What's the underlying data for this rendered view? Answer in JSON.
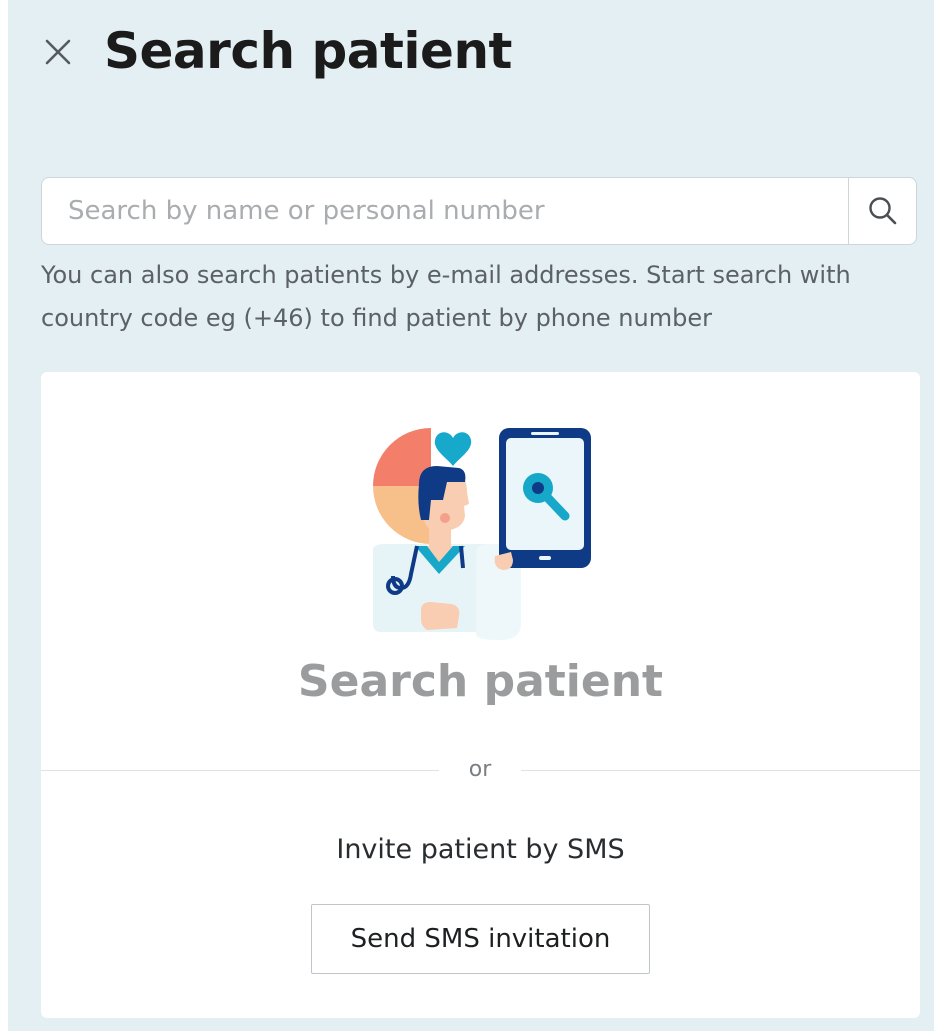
{
  "header": {
    "title": "Search patient",
    "close_icon": "close-icon"
  },
  "search": {
    "placeholder": "Search by name or personal number",
    "value": "",
    "button_icon": "search-icon",
    "hint": "You can also search patients by e-mail addresses. Start search with country code eg (+46) to find patient by phone number"
  },
  "card": {
    "illustration": "doctor-with-phone-illustration",
    "title": "Search patient",
    "divider_label": "or",
    "invite_text": "Invite patient by SMS",
    "invite_button_label": "Send SMS invitation"
  },
  "colors": {
    "panel_background": "#e3eff2",
    "card_background": "#ffffff",
    "accent_teal": "#1ba8c7",
    "navy": "#0e3a86",
    "coral": "#f37f6a"
  }
}
